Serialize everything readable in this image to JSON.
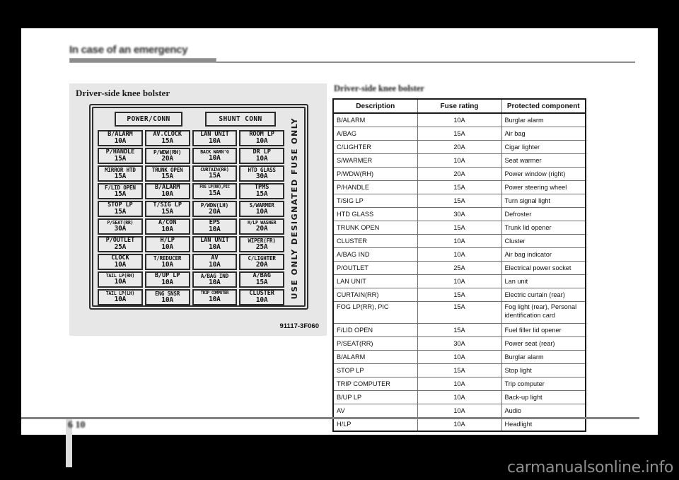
{
  "header": {
    "chapter_title": "In case of an emergency"
  },
  "figure": {
    "title": "Driver-side knee bolster",
    "caption": "91117-3F060",
    "vertical_notice": "USE ONLY DESIGNATED FUSE ONLY",
    "connectors": [
      {
        "label": "POWER/CONN"
      },
      {
        "label": "SHUNT  CONN"
      }
    ],
    "fuses": [
      {
        "name": "B/ALARM",
        "rating": "10A",
        "size": "lg"
      },
      {
        "name": "AV.CLOCK",
        "rating": "15A",
        "size": "lg"
      },
      {
        "name": "LAN UNIT",
        "rating": "10A",
        "size": "lg"
      },
      {
        "name": "ROOM LP",
        "rating": "10A",
        "size": "lg"
      },
      {
        "name": "P/HANDLE",
        "rating": "15A",
        "size": "lg"
      },
      {
        "name": "P/WDW(RH)",
        "rating": "20A",
        "size": "md"
      },
      {
        "name": "BACK WARN'G",
        "rating": "10A",
        "size": "sm"
      },
      {
        "name": "DR LP",
        "rating": "10A",
        "size": "lg"
      },
      {
        "name": "MIRROR HTD",
        "rating": "15A",
        "size": "md"
      },
      {
        "name": "TRUNK OPEN",
        "rating": "15A",
        "size": "md"
      },
      {
        "name": "CURTAIN(RR)",
        "rating": "15A",
        "size": "sm"
      },
      {
        "name": "HTD GLASS",
        "rating": "30A",
        "size": "md"
      },
      {
        "name": "F/LID OPEN",
        "rating": "15A",
        "size": "md"
      },
      {
        "name": "B/ALARM",
        "rating": "10A",
        "size": "lg"
      },
      {
        "name": "FOG LP(RR),PIC",
        "rating": "15A",
        "size": "xs"
      },
      {
        "name": "TPMS",
        "rating": "15A",
        "size": "lg"
      },
      {
        "name": "STOP LP",
        "rating": "15A",
        "size": "lg"
      },
      {
        "name": "T/SIG LP",
        "rating": "15A",
        "size": "lg"
      },
      {
        "name": "P/WDW(LH)",
        "rating": "20A",
        "size": "md"
      },
      {
        "name": "S/WARMER",
        "rating": "10A",
        "size": "md"
      },
      {
        "name": "P/SEAT(RR)",
        "rating": "30A",
        "size": "sm"
      },
      {
        "name": "A/CON",
        "rating": "10A",
        "size": "lg"
      },
      {
        "name": "EPS",
        "rating": "10A",
        "size": "lg"
      },
      {
        "name": "H/LP WASHER",
        "rating": "20A",
        "size": "sm"
      },
      {
        "name": "P/OUTLET",
        "rating": "25A",
        "size": "lg"
      },
      {
        "name": "H/LP",
        "rating": "10A",
        "size": "lg"
      },
      {
        "name": "LAN UNIT",
        "rating": "10A",
        "size": "lg"
      },
      {
        "name": "WIPER(FR)",
        "rating": "25A",
        "size": "md"
      },
      {
        "name": "CLOCK",
        "rating": "10A",
        "size": "lg"
      },
      {
        "name": "T/REDUCER",
        "rating": "10A",
        "size": "md"
      },
      {
        "name": "AV",
        "rating": "10A",
        "size": "lg"
      },
      {
        "name": "C/LIGHTER",
        "rating": "20A",
        "size": "md"
      },
      {
        "name": "TAIL LP(RH)",
        "rating": "10A",
        "size": "sm"
      },
      {
        "name": "B/UP LP",
        "rating": "10A",
        "size": "lg"
      },
      {
        "name": "A/BAG IND",
        "rating": "10A",
        "size": "md"
      },
      {
        "name": "A/BAG",
        "rating": "15A",
        "size": "lg"
      },
      {
        "name": "TAIL LP(LH)",
        "rating": "10A",
        "size": "sm"
      },
      {
        "name": "ENG SNSR",
        "rating": "10A",
        "size": "md"
      },
      {
        "name": "TRIP COMPUTER",
        "rating": "10A",
        "size": "xs"
      },
      {
        "name": "CLUSTER",
        "rating": "10A",
        "size": "lg"
      }
    ]
  },
  "table": {
    "title": "Driver-side knee bolster",
    "columns": [
      "Description",
      "Fuse rating",
      "Protected component"
    ],
    "rows": [
      {
        "description": "B/ALARM",
        "rating": "10A",
        "component": "Burglar alarm"
      },
      {
        "description": "A/BAG",
        "rating": "15A",
        "component": "Air bag"
      },
      {
        "description": "C/LIGHTER",
        "rating": "20A",
        "component": "Cigar lighter"
      },
      {
        "description": "S/WARMER",
        "rating": "10A",
        "component": "Seat warmer"
      },
      {
        "description": "P/WDW(RH)",
        "rating": "20A",
        "component": "Power window (right)"
      },
      {
        "description": "P/HANDLE",
        "rating": "15A",
        "component": "Power steering wheel"
      },
      {
        "description": "T/SIG LP",
        "rating": "15A",
        "component": "Turn signal light"
      },
      {
        "description": "HTD GLASS",
        "rating": "30A",
        "component": "Defroster"
      },
      {
        "description": "TRUNK OPEN",
        "rating": "15A",
        "component": "Trunk lid opener"
      },
      {
        "description": "CLUSTER",
        "rating": "10A",
        "component": "Cluster"
      },
      {
        "description": "A/BAG IND",
        "rating": "10A",
        "component": "Air bag indicator"
      },
      {
        "description": "P/OUTLET",
        "rating": "25A",
        "component": "Electrical power socket"
      },
      {
        "description": "LAN UNIT",
        "rating": "10A",
        "component": "Lan unit"
      },
      {
        "description": "CURTAIN(RR)",
        "rating": "15A",
        "component": "Electric curtain (rear)"
      },
      {
        "description": "FOG LP(RR), PIC",
        "rating": "15A",
        "component": "Fog light (rear), Personal identification card",
        "tall": true
      },
      {
        "description": "F/LID OPEN",
        "rating": "15A",
        "component": "Fuel filler lid opener"
      },
      {
        "description": "P/SEAT(RR)",
        "rating": "30A",
        "component": "Power seat (rear)"
      },
      {
        "description": "B/ALARM",
        "rating": "10A",
        "component": "Burglar alarm"
      },
      {
        "description": "STOP LP",
        "rating": "15A",
        "component": "Stop light"
      },
      {
        "description": "TRIP COMPUTER",
        "rating": "10A",
        "component": "Trip computer"
      },
      {
        "description": "B/UP LP",
        "rating": "10A",
        "component": "Back-up light"
      },
      {
        "description": "AV",
        "rating": "10A",
        "component": "Audio"
      },
      {
        "description": "H/LP",
        "rating": "10A",
        "component": "Headlight"
      }
    ]
  },
  "footer": {
    "page_number": "6 10",
    "watermark": "carmanualsonline.info"
  }
}
